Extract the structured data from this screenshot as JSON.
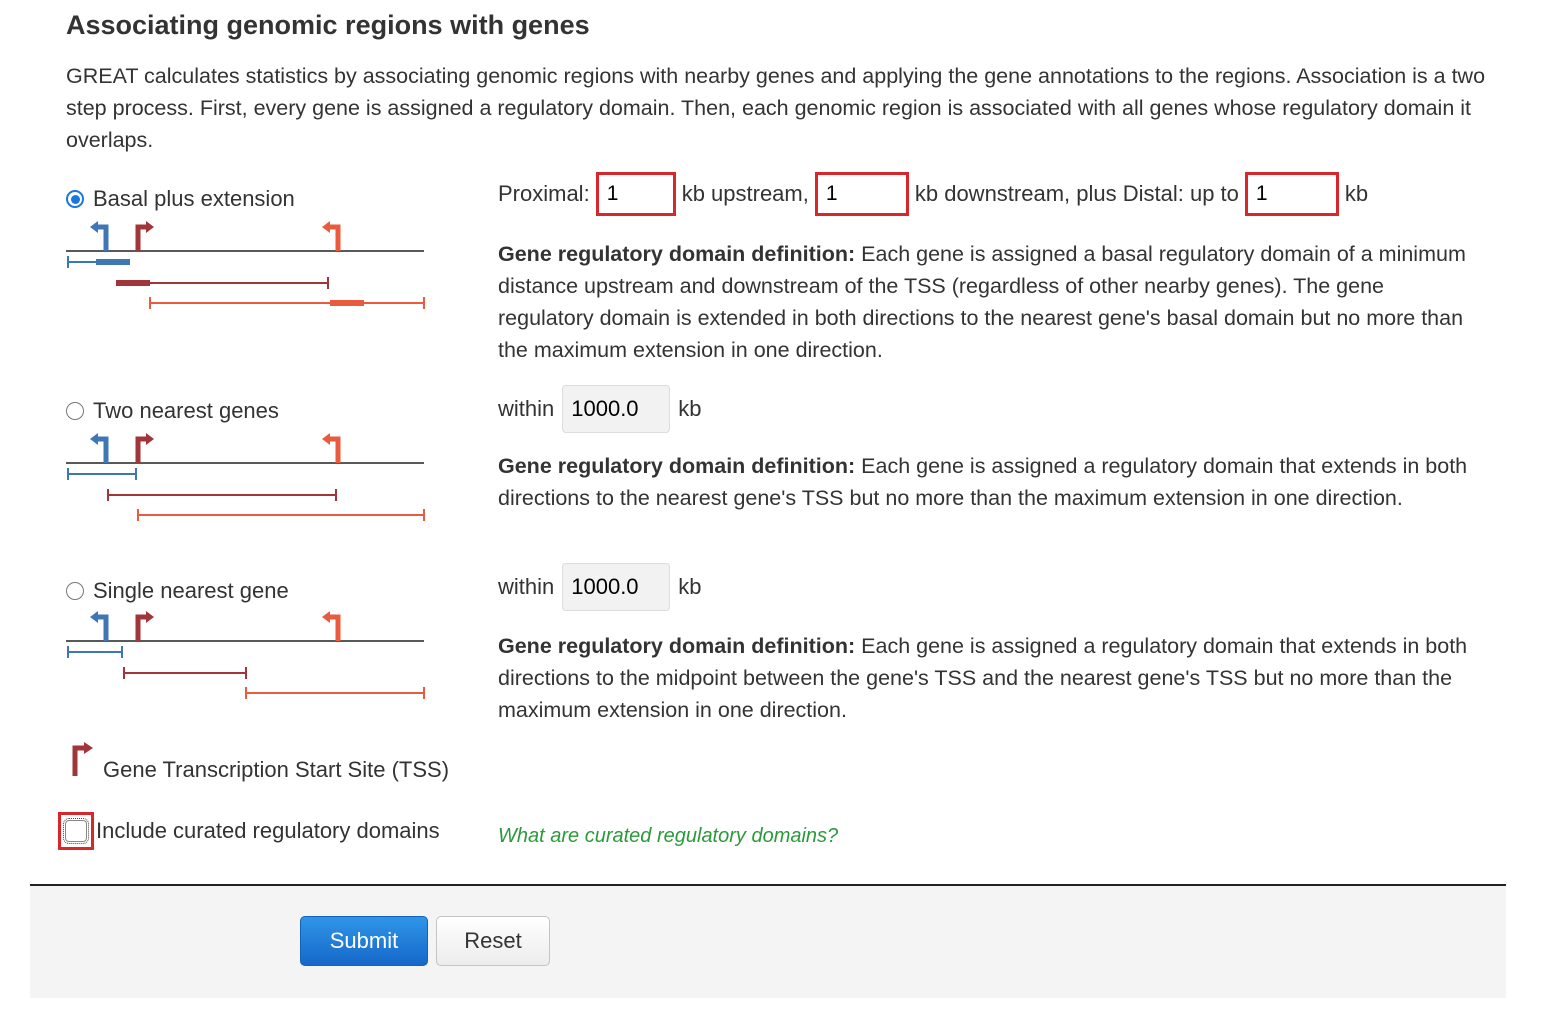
{
  "header": {
    "title": "Associating genomic regions with genes",
    "intro": "GREAT calculates statistics by associating genomic regions with nearby genes and applying the gene annotations to the regions. Association is a two step process. First, every gene is assigned a regulatory domain. Then, each genomic region is associated with all genes whose regulatory domain it overlaps."
  },
  "options": {
    "basal": {
      "label": "Basal plus extension",
      "selected": true,
      "proximal_label": "Proximal:",
      "upstream_value": "1",
      "upstream_unit": "kb upstream,",
      "downstream_value": "1",
      "downstream_unit": "kb downstream, plus Distal: up to",
      "distal_value": "1",
      "distal_unit": "kb",
      "definition_heading": "Gene regulatory domain definition:",
      "definition_text": " Each gene is assigned a basal regulatory domain of a minimum distance upstream and downstream of the TSS (regardless of other nearby genes). The gene regulatory domain is extended in both directions to the nearest gene's basal domain but no more than the maximum extension in one direction."
    },
    "two_nearest": {
      "label": "Two nearest genes",
      "selected": false,
      "within_label": "within",
      "value": "1000.0",
      "unit": "kb",
      "definition_heading": "Gene regulatory domain definition:",
      "definition_text": " Each gene is assigned a regulatory domain that extends in both directions to the nearest gene's TSS but no more than the maximum extension in one direction."
    },
    "single_nearest": {
      "label": "Single nearest gene",
      "selected": false,
      "within_label": "within",
      "value": "1000.0",
      "unit": "kb",
      "definition_heading": "Gene regulatory domain definition:",
      "definition_text": " Each gene is assigned a regulatory domain that extends in both directions to the midpoint between the gene's TSS and the nearest gene's TSS but no more than the maximum extension in one direction."
    }
  },
  "legend": {
    "label": "Gene Transcription Start Site (TSS)",
    "icon": "tss-arrow-icon"
  },
  "curated": {
    "label": "Include curated regulatory domains",
    "checked": false,
    "help_link": "What are curated regulatory domains?"
  },
  "footer": {
    "submit_label": "Submit",
    "reset_label": "Reset"
  },
  "colors": {
    "blue_gene": "#3f76b4",
    "dark_red_gene": "#a0353a",
    "orange_gene": "#e85b3e",
    "highlight": "#d9262a",
    "link_green": "#2a9a3a",
    "submit_blue": "#1f7ad6"
  }
}
